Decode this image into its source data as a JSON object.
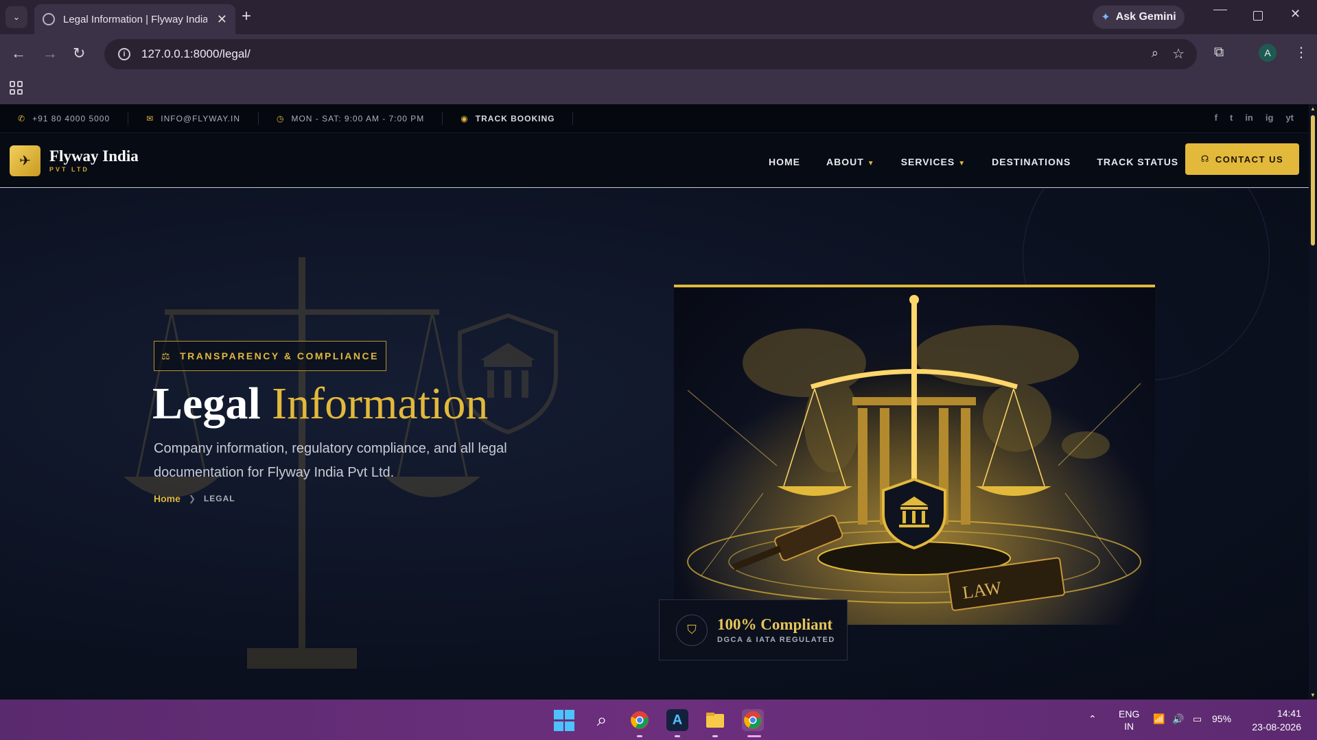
{
  "browser": {
    "tab_title": "Legal Information | Flyway India",
    "gemini_label": "Ask Gemini",
    "url": "127.0.0.1:8000/legal/",
    "profile_initial": "A"
  },
  "topbar": {
    "phone": "+91 80 4000 5000",
    "email": "INFO@FLYWAY.IN",
    "hours": "MON - SAT: 9:00 AM - 7:00 PM",
    "track": "TRACK BOOKING",
    "socials": [
      "f",
      "t",
      "in",
      "ig",
      "yt"
    ]
  },
  "header": {
    "brand": "Flyway India",
    "brand_sub": "PVT LTD",
    "nav": [
      "HOME",
      "ABOUT",
      "SERVICES",
      "DESTINATIONS",
      "TRACK STATUS"
    ],
    "contact_label": "CONTACT US"
  },
  "hero": {
    "pill": "TRANSPARENCY & COMPLIANCE",
    "title_part1": "Legal",
    "title_part2": "Information",
    "lead": "Company information, regulatory compliance, and all legal documentation for Flyway India Pvt Ltd.",
    "crumb_home": "Home",
    "crumb_current": "LEGAL",
    "badge_title": "100% Compliant",
    "badge_sub": "DGCA & IATA REGULATED",
    "art_book": "LAW"
  },
  "taskbar": {
    "lang1": "ENG",
    "lang2": "IN",
    "battery": "95%",
    "time": "14:41",
    "date": "23-08-2026"
  },
  "colors": {
    "gold": "#e2b93b",
    "navy": "#0b1120",
    "chrome": "#3b3247"
  }
}
